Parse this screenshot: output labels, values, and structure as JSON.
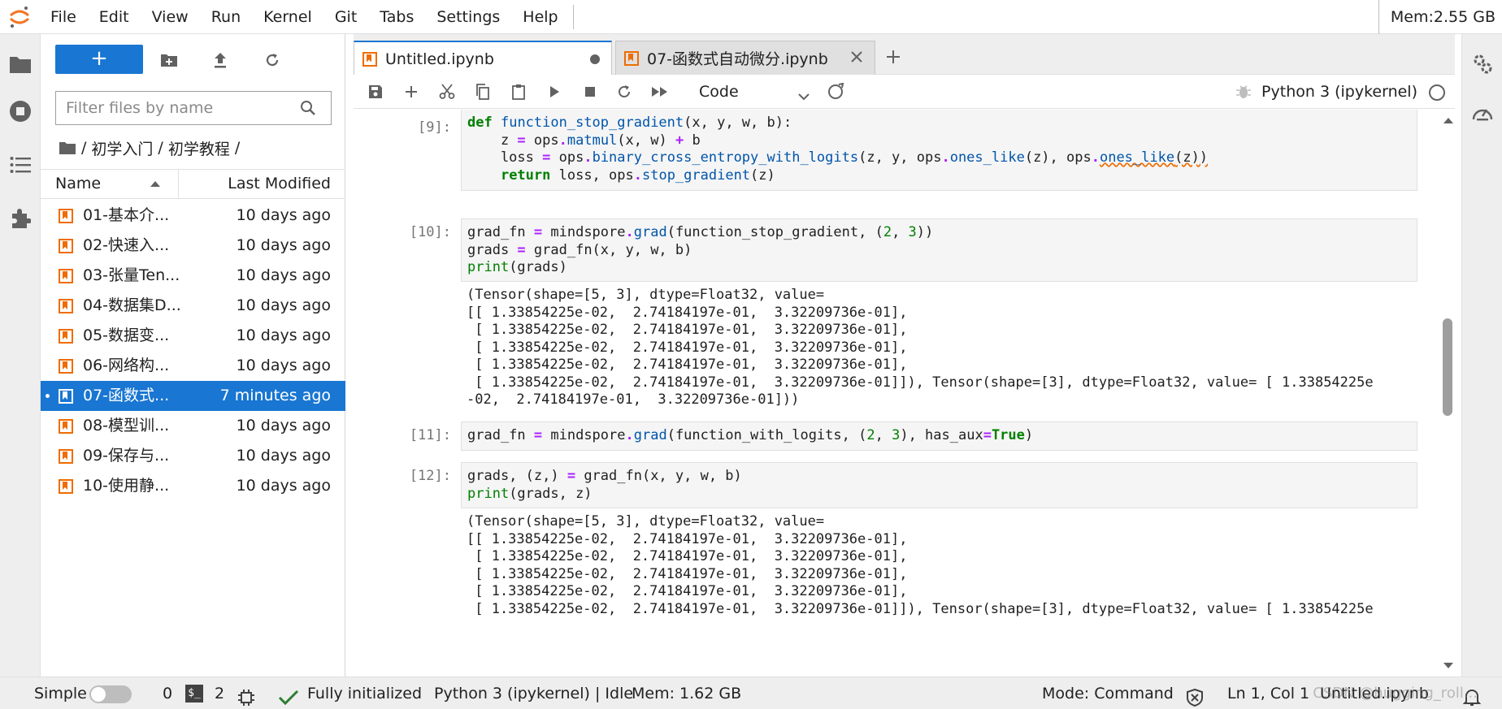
{
  "menubar": {
    "items": [
      "File",
      "Edit",
      "View",
      "Run",
      "Kernel",
      "Git",
      "Tabs",
      "Settings",
      "Help"
    ],
    "memory": "Mem:2.55 GB"
  },
  "filebrowser": {
    "new_label": "+",
    "search_placeholder": "Filter files by name",
    "breadcrumbs": [
      "/",
      "初学入门",
      "/",
      "初学教程",
      "/"
    ],
    "col_name": "Name",
    "col_modified": "Last Modified",
    "files": [
      {
        "name": "01-基本介...",
        "modified": "10 days ago"
      },
      {
        "name": "02-快速入...",
        "modified": "10 days ago"
      },
      {
        "name": "03-张量Ten...",
        "modified": "10 days ago"
      },
      {
        "name": "04-数据集D...",
        "modified": "10 days ago"
      },
      {
        "name": "05-数据变...",
        "modified": "10 days ago"
      },
      {
        "name": "06-网络构...",
        "modified": "10 days ago"
      },
      {
        "name": "07-函数式...",
        "modified": "7 minutes ago"
      },
      {
        "name": "08-模型训...",
        "modified": "10 days ago"
      },
      {
        "name": "09-保存与...",
        "modified": "10 days ago"
      },
      {
        "name": "10-使用静...",
        "modified": "10 days ago"
      }
    ]
  },
  "tabs": [
    {
      "label": "Untitled.ipynb",
      "active": true
    },
    {
      "label": "07-函数式自动微分.ipynb",
      "active": false
    }
  ],
  "toolbar": {
    "cell_type": "Code",
    "kernel": "Python 3 (ipykernel)"
  },
  "cells": {
    "c9": {
      "prompt": "[9]:"
    },
    "c10": {
      "prompt": "[10]:"
    },
    "c11": {
      "prompt": "[11]:"
    },
    "c12": {
      "prompt": "[12]:"
    }
  },
  "outputs": {
    "o10": [
      "(Tensor(shape=[5, 3], dtype=Float32, value=",
      "[[ 1.33854225e-02,  2.74184197e-01,  3.32209736e-01],",
      " [ 1.33854225e-02,  2.74184197e-01,  3.32209736e-01],",
      " [ 1.33854225e-02,  2.74184197e-01,  3.32209736e-01],",
      " [ 1.33854225e-02,  2.74184197e-01,  3.32209736e-01],",
      " [ 1.33854225e-02,  2.74184197e-01,  3.32209736e-01]]), Tensor(shape=[3], dtype=Float32, value= [ 1.33854225e",
      "-02,  2.74184197e-01,  3.32209736e-01]))"
    ],
    "o12": [
      "(Tensor(shape=[5, 3], dtype=Float32, value=",
      "[[ 1.33854225e-02,  2.74184197e-01,  3.32209736e-01],",
      " [ 1.33854225e-02,  2.74184197e-01,  3.32209736e-01],",
      " [ 1.33854225e-02,  2.74184197e-01,  3.32209736e-01],",
      " [ 1.33854225e-02,  2.74184197e-01,  3.32209736e-01],",
      " [ 1.33854225e-02,  2.74184197e-01,  3.32209736e-01]]), Tensor(shape=[3], dtype=Float32, value= [ 1.33854225e"
    ]
  },
  "statusbar": {
    "simple": "Simple",
    "terminals": "0",
    "kernels": "2",
    "initialized": "Fully initialized",
    "kernel_status": "Python 3 (ipykernel) | Idle",
    "mem": "Mem: 1.62 GB",
    "mode": "Mode: Command",
    "position": "Ln 1, Col 1",
    "file": "Untitled.ipynb",
    "watermark": "CSDN @hugging_roll..."
  },
  "colors": {
    "accent": "#1976d2",
    "notebook_icon": "#ef6c00"
  }
}
